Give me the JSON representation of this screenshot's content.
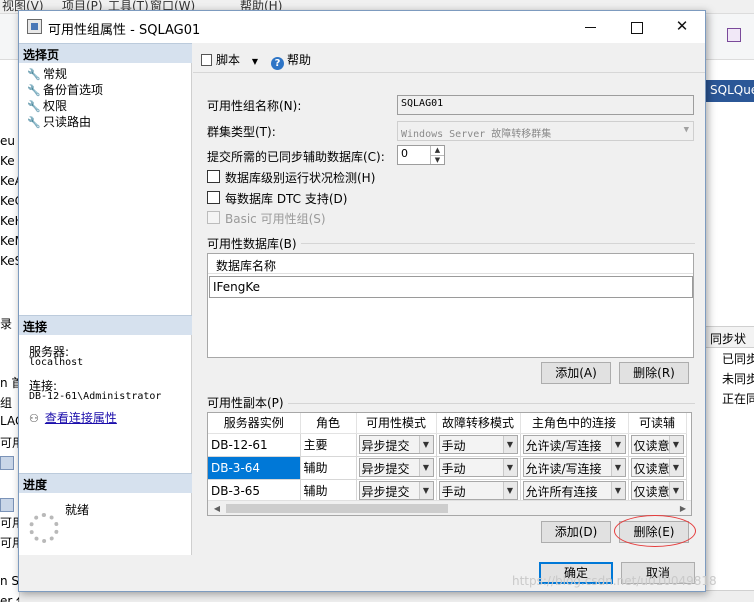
{
  "background": {
    "menu": [
      "视图(V)",
      "项目(P)",
      "工具(T)",
      "窗口(W)",
      "帮助(H)"
    ],
    "tree_items": [
      "eu",
      "Ke",
      "KeA",
      "KeC",
      "KeH",
      "KeM",
      "KeS",
      "录",
      "n 首",
      "组",
      "LAG",
      "可用",
      "可用",
      "可用",
      "n S",
      "er 代理"
    ],
    "right_tab": "SQLQue",
    "right_header": "同步状",
    "right_rows": [
      "已同步",
      "未同步",
      "正在同"
    ]
  },
  "dialog": {
    "title": "可用性组属性 - SQLAG01",
    "title_buttons": {
      "min": "—",
      "max": "☐",
      "close": "✕"
    }
  },
  "left": {
    "select_page_header": "选择页",
    "pages": [
      "常规",
      "备份首选项",
      "权限",
      "只读路由"
    ],
    "connection_header": "连接",
    "server_label": "服务器:",
    "server_value": "localhost",
    "connection_label": "连接:",
    "connection_value": "DB-12-61\\Administrator",
    "view_connection_properties": "查看连接属性",
    "progress_header": "进度",
    "progress_status": "就绪"
  },
  "toolbar": {
    "script_label": "脚本",
    "help_label": "帮助"
  },
  "form": {
    "ag_name_label": "可用性组名称(N):",
    "ag_name_value": "SQLAG01",
    "cluster_type_label": "群集类型(T):",
    "cluster_type_value": "Windows Server 故障转移群集",
    "sync_secondaries_label": "提交所需的已同步辅助数据库(C):",
    "sync_secondaries_value": "0",
    "db_health_label": "数据库级别运行状况检测(H)",
    "per_db_dtc_label": "每数据库 DTC 支持(D)",
    "basic_ag_label": "Basic 可用性组(S)"
  },
  "databases": {
    "group_label": "可用性数据库(B)",
    "column_header": "数据库名称",
    "rows": [
      "IFengKe"
    ],
    "add_button": "添加(A)",
    "remove_button": "删除(R)"
  },
  "replicas": {
    "group_label": "可用性副本(P)",
    "columns": [
      "服务器实例",
      "角色",
      "可用性模式",
      "故障转移模式",
      "主角色中的连接",
      "可读辅"
    ],
    "rows": [
      {
        "server": "DB-12-61",
        "role": "主要",
        "availability": "异步提交",
        "failover": "手动",
        "primary_conn": "允许读/写连接",
        "readable": "仅读意向"
      },
      {
        "server": "DB-3-64",
        "role": "辅助",
        "availability": "异步提交",
        "failover": "手动",
        "primary_conn": "允许读/写连接",
        "readable": "仅读意向"
      },
      {
        "server": "DB-3-65",
        "role": "辅助",
        "availability": "异步提交",
        "failover": "手动",
        "primary_conn": "允许所有连接",
        "readable": "仅读意向"
      }
    ],
    "selected_row": 1,
    "add_button": "添加(D)",
    "remove_button": "删除(E)"
  },
  "footer": {
    "ok_button": "确定",
    "cancel_button": "取消"
  },
  "watermark": "https://blog.csdn.net/u010049818",
  "colors": {
    "selection": "#0078d7",
    "section_header": "#d6e1ee",
    "annotation_circle": "#e53c3c"
  }
}
